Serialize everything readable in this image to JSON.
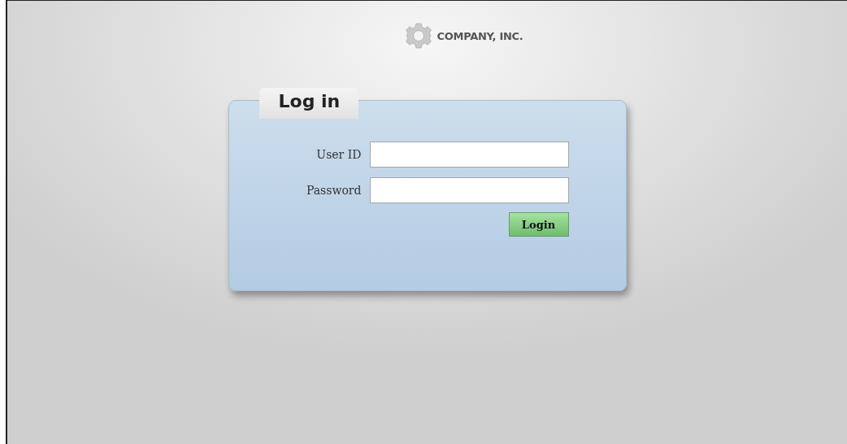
{
  "header": {
    "company": "COMPANY, INC."
  },
  "login_panel": {
    "tab": "Log in",
    "fields": [
      {
        "label": "User ID"
      },
      {
        "label": "Password"
      }
    ],
    "submit_button": "Login"
  }
}
